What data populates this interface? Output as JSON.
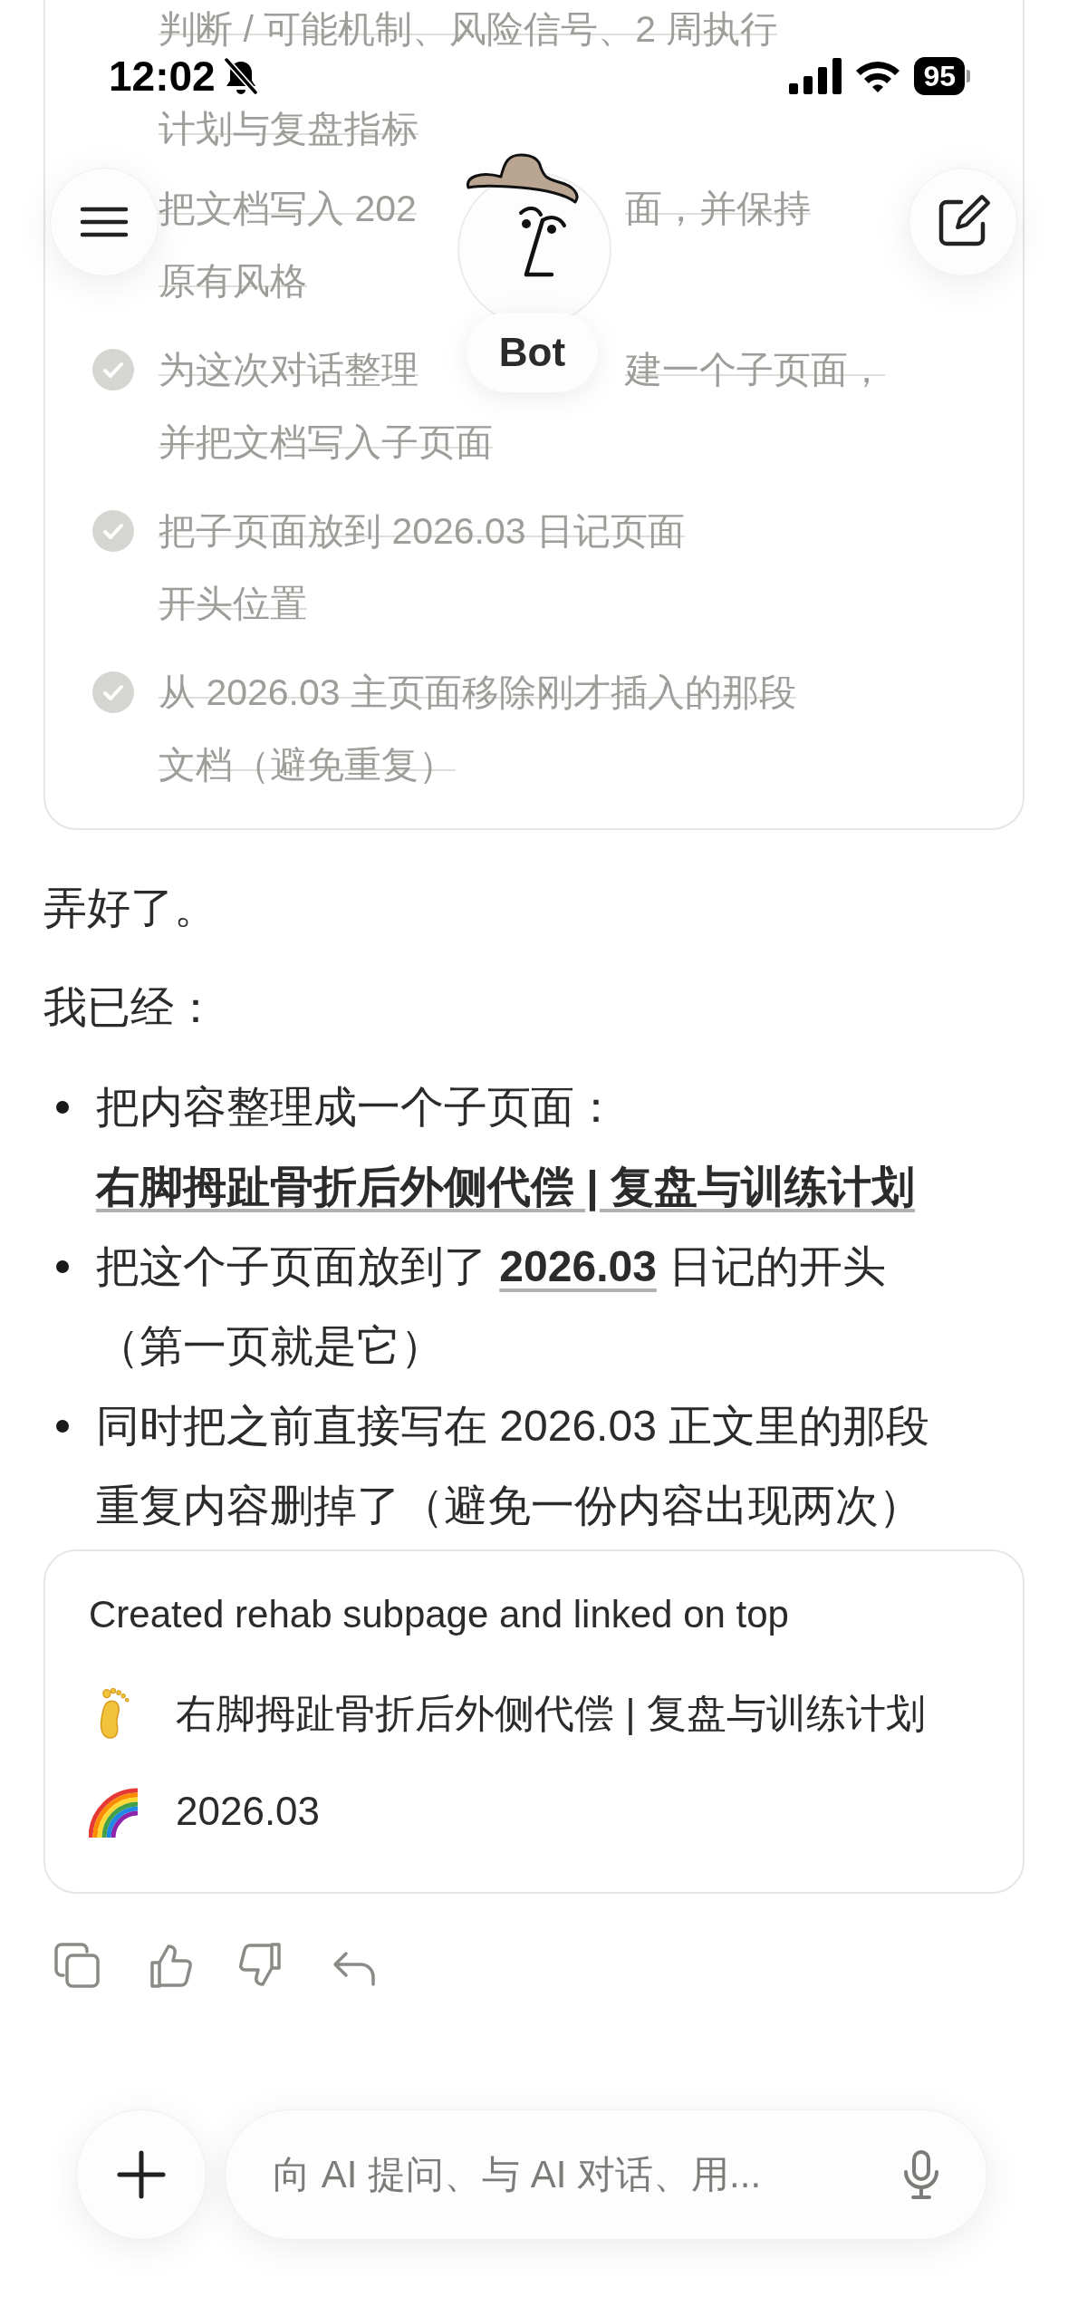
{
  "status_bar": {
    "time": "12:02",
    "battery": "95"
  },
  "header": {
    "bot_name": "Bot"
  },
  "task_list": [
    {
      "kind": "continued",
      "checked": true,
      "lines": [
        [
          "判断 / 可能机制、风险信号、2 周执行"
        ],
        [
          "计划与复盘指标"
        ]
      ]
    },
    {
      "kind": "continued",
      "checked": true,
      "lines": [
        [
          "把文档写入 202",
          "面，并保持"
        ],
        [
          "原有风格"
        ]
      ]
    },
    {
      "kind": "task",
      "checked": true,
      "lines": [
        [
          "为这次对话整理",
          "建一个子页面，"
        ],
        [
          "并把文档写入子页面"
        ]
      ]
    },
    {
      "kind": "task",
      "checked": true,
      "lines": [
        [
          "把子页面放到 2026.03 日记页面"
        ],
        [
          "开头位置"
        ]
      ]
    },
    {
      "kind": "task",
      "checked": true,
      "lines": [
        [
          "从 2026.03 主页面移除刚才插入的那段"
        ],
        [
          "文档（避免重复）"
        ]
      ]
    }
  ],
  "message": {
    "paragraphs": [
      "弄好了。",
      "我已经："
    ],
    "bullets": [
      {
        "segments": [
          {
            "kind": "text",
            "text": "把内容整理成一个子页面："
          },
          {
            "kind": "link",
            "text": "右脚拇趾骨折后外侧代偿 | 复盘与训练计划"
          }
        ]
      },
      {
        "segments": [
          {
            "kind": "text",
            "text": "把这个子页面放到了 "
          },
          {
            "kind": "link",
            "text": "2026.03"
          },
          {
            "kind": "text",
            "text": " 日记的开头（第一页就是它）"
          }
        ]
      },
      {
        "segments": [
          {
            "kind": "text",
            "text": "同时把之前直接写在 2026.03 正文里的那段重复内容删掉了（避免一份内容出现两次）"
          }
        ]
      }
    ]
  },
  "result_card": {
    "title": "Created rehab subpage and linked on top",
    "pages": [
      {
        "title": "右脚拇趾骨折后外侧代偿 | 复盘与训练计划"
      },
      {
        "title": "2026.03"
      }
    ]
  },
  "composer": {
    "placeholder": "向 AI 提问、与 AI 对话、用..."
  }
}
